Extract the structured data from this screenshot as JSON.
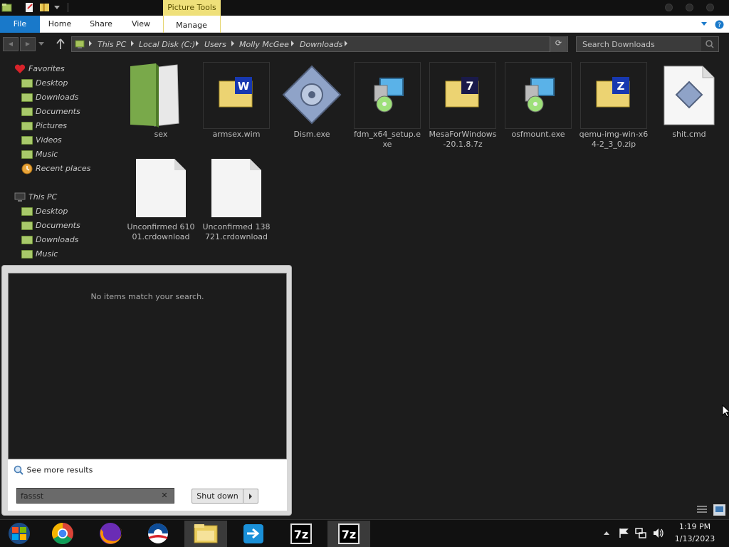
{
  "quick_access": {
    "icons": [
      "properties-icon",
      "new-folder-icon",
      "customize-icon"
    ]
  },
  "ribbon": {
    "context_header": "Picture Tools",
    "tabs": [
      "File",
      "Home",
      "Share",
      "View",
      "Manage"
    ]
  },
  "address": {
    "crumbs": [
      "This PC",
      "Local Disk (C:)",
      "Users",
      "Molly McGee",
      "Downloads"
    ]
  },
  "search": {
    "placeholder": "Search Downloads"
  },
  "nav": {
    "favorites_header": "Favorites",
    "favorites": [
      "Desktop",
      "Downloads",
      "Documents",
      "Pictures",
      "Videos",
      "Music",
      "Recent places"
    ],
    "thispc_header": "This PC",
    "thispc": [
      "Desktop",
      "Documents",
      "Downloads",
      "Music"
    ]
  },
  "files": [
    {
      "name": "sex",
      "icon": "folder-icon"
    },
    {
      "name": "armsex.wim",
      "icon": "archive-w-icon"
    },
    {
      "name": "Dism.exe",
      "icon": "gear-app-icon"
    },
    {
      "name": "fdm_x64_setup.exe",
      "icon": "installer-icon"
    },
    {
      "name": "MesaForWindows-20.1.8.7z",
      "icon": "archive-7z-icon"
    },
    {
      "name": "osfmount.exe",
      "icon": "installer-icon"
    },
    {
      "name": "qemu-img-win-x64-2_3_0.zip",
      "icon": "archive-zip-icon"
    },
    {
      "name": "shit.cmd",
      "icon": "script-icon"
    },
    {
      "name": "Unconfirmed 61001.crdownload",
      "icon": "blank-file-icon"
    },
    {
      "name": "Unconfirmed 138721.crdownload",
      "icon": "blank-file-icon"
    }
  ],
  "start_menu": {
    "no_results": "No items match your search.",
    "see_more": "See more results",
    "search_value": "fassst",
    "shutdown_label": "Shut down"
  },
  "taskbar": {
    "apps": [
      "start-orb-icon",
      "chrome-icon",
      "firefox-icon",
      "obama-logo-icon",
      "file-explorer-icon",
      "teamviewer-icon",
      "7zip-icon",
      "7zip-icon"
    ]
  },
  "clock": {
    "time": "1:19 PM",
    "date": "1/13/2023"
  },
  "colors": {
    "file_tab": "#1979ca",
    "context_tab": "#efe07a",
    "background": "#1c1c1c"
  }
}
